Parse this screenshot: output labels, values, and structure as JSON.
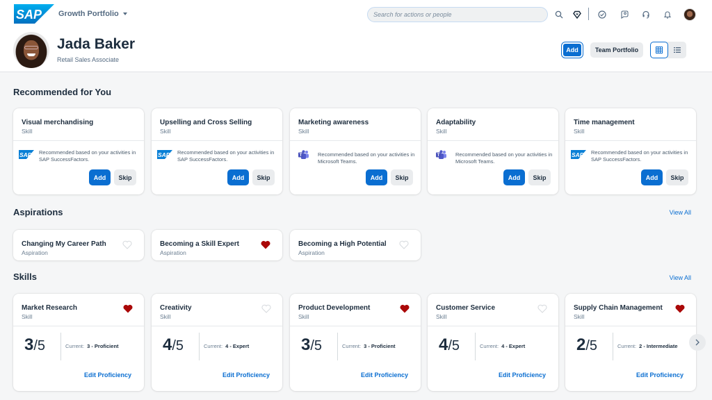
{
  "shell": {
    "product_name": "Growth Portfolio",
    "search_placeholder": "Search for actions or people",
    "icons": [
      "search-icon",
      "diamond-icon",
      "check-circle-icon",
      "people-chat-icon",
      "headset-icon",
      "bell-icon",
      "user-avatar"
    ]
  },
  "header": {
    "name": "Jada Baker",
    "role": "Retail Sales Associate",
    "add_label": "Add",
    "team_portfolio_label": "Team Portfolio",
    "view_modes": [
      "grid",
      "list"
    ],
    "active_view": "grid"
  },
  "recommended": {
    "title": "Recommended for You",
    "add_label": "Add",
    "skip_label": "Skip",
    "cards": [
      {
        "title": "Visual merchandising",
        "type": "Skill",
        "source": "sap",
        "reason": "Recommended based on your activities in SAP SuccessFactors."
      },
      {
        "title": "Upselling and Cross Selling",
        "type": "Skill",
        "source": "sap",
        "reason": "Recommended based on your activities in SAP SuccessFactors."
      },
      {
        "title": "Marketing awareness",
        "type": "Skill",
        "source": "teams",
        "reason": "Recommended based on your activities in Microsoft Teams."
      },
      {
        "title": "Adaptability",
        "type": "Skill",
        "source": "teams",
        "reason": "Recommended based on your activities in Microsoft Teams."
      },
      {
        "title": "Time management",
        "type": "Skill",
        "source": "sap",
        "reason": "Recommended based on your activities in SAP SuccessFactors."
      }
    ]
  },
  "aspirations": {
    "title": "Aspirations",
    "view_all": "View All",
    "cards": [
      {
        "title": "Changing My Career Path",
        "type": "Aspiration",
        "favorite": false
      },
      {
        "title": "Becoming a Skill Expert",
        "type": "Aspiration",
        "favorite": true
      },
      {
        "title": "Becoming a High Potential",
        "type": "Aspiration",
        "favorite": false
      }
    ]
  },
  "skills": {
    "title": "Skills",
    "view_all": "View All",
    "current_label": "Current:",
    "edit_label": "Edit Proficiency",
    "cards": [
      {
        "title": "Market Research",
        "type": "Skill",
        "favorite": true,
        "score": "3",
        "max": "/5",
        "current": "3 - Proficient"
      },
      {
        "title": "Creativity",
        "type": "Skill",
        "favorite": false,
        "score": "4",
        "max": "/5",
        "current": "4 - Expert"
      },
      {
        "title": "Product Development",
        "type": "Skill",
        "favorite": true,
        "score": "3",
        "max": "/5",
        "current": "3 - Proficient"
      },
      {
        "title": "Customer Service",
        "type": "Skill",
        "favorite": false,
        "score": "4",
        "max": "/5",
        "current": "4 - Expert"
      },
      {
        "title": "Supply Chain Management",
        "type": "Skill",
        "favorite": true,
        "score": "2",
        "max": "/5",
        "current": "2 - Intermediate"
      }
    ]
  },
  "colors": {
    "brand_blue": "#0a6ed1",
    "heart_red": "#aa0808",
    "background": "#f5f6f7"
  }
}
